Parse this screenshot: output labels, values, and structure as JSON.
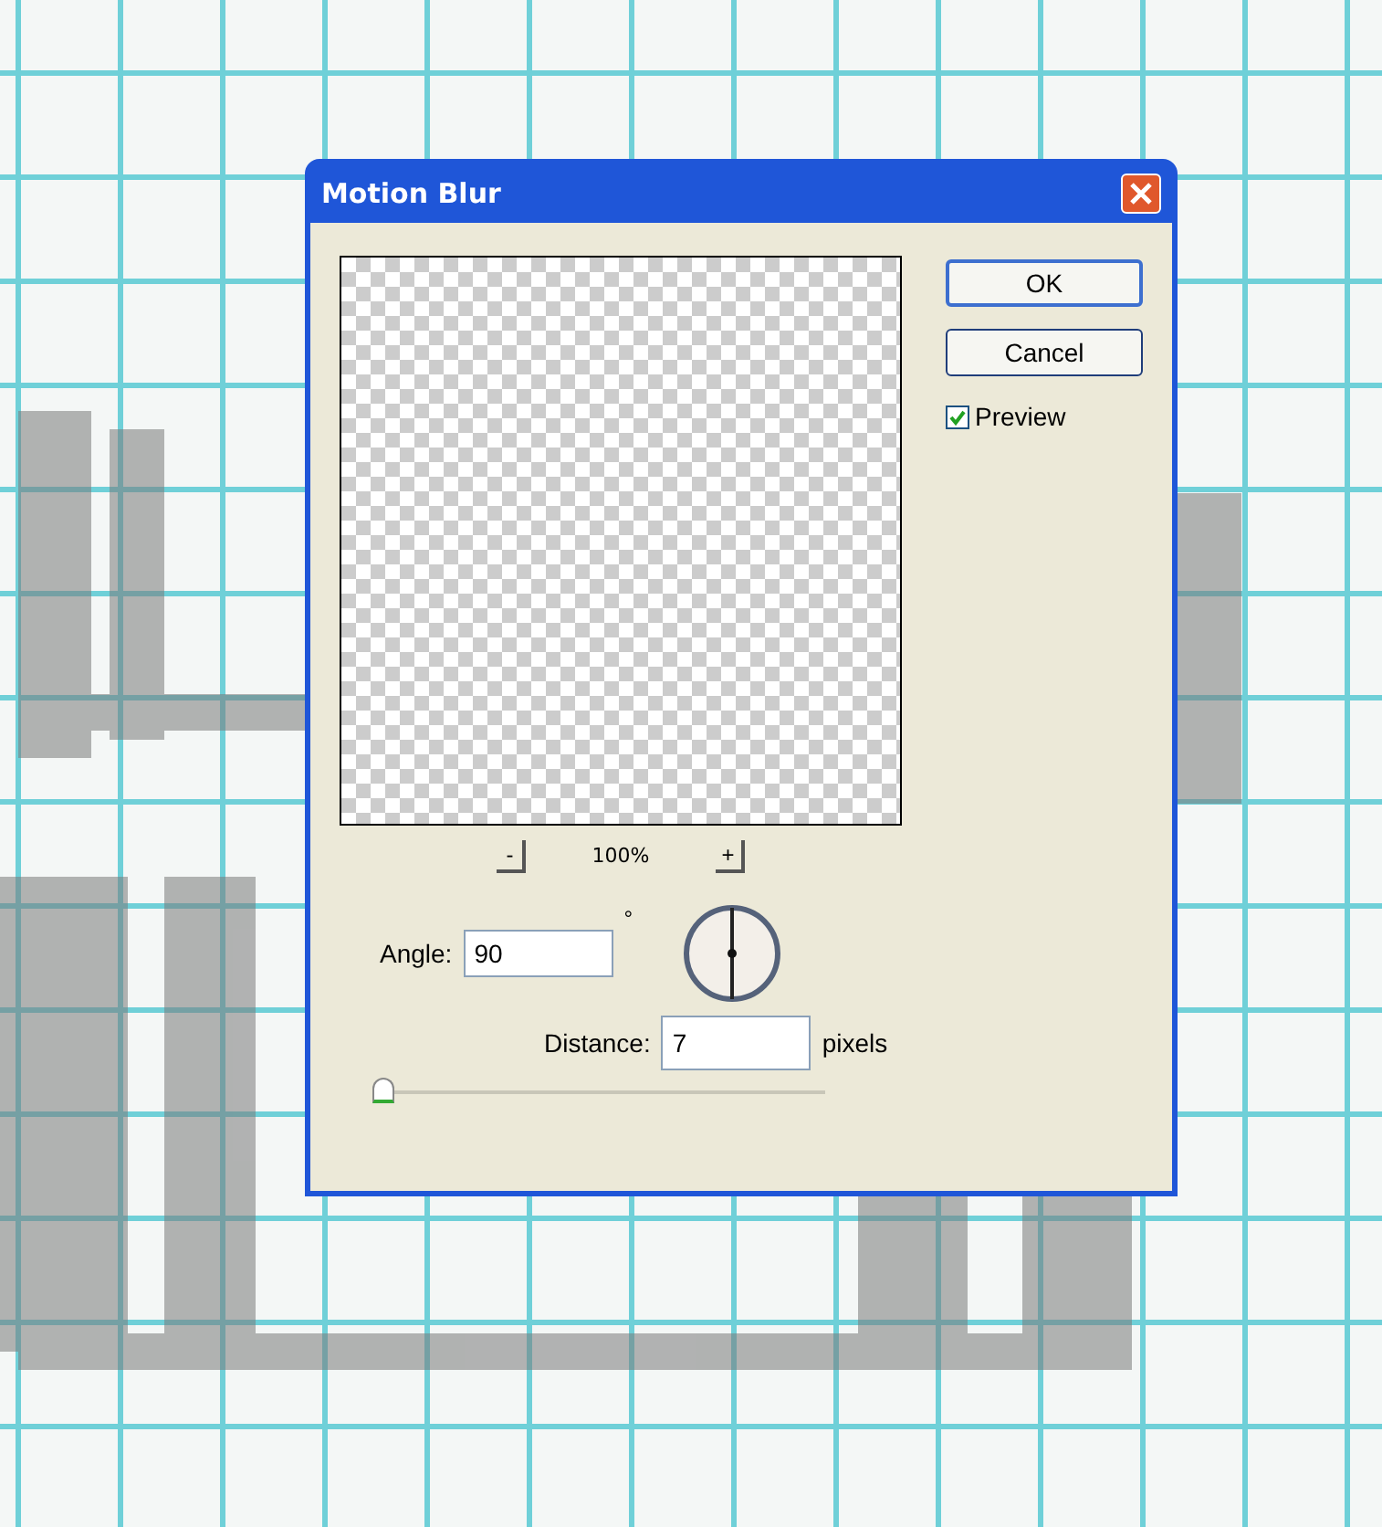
{
  "window": {
    "title": "Motion Blur"
  },
  "buttons": [
    {
      "label": "OK",
      "default": true
    },
    {
      "label": "Cancel",
      "default": false
    }
  ],
  "preview_checkbox": {
    "label": "Preview",
    "checked": true
  },
  "zoom": {
    "minus": "-",
    "value": "100%",
    "plus": "+"
  },
  "angle": {
    "label": "Angle:",
    "value": "90",
    "unit": "°"
  },
  "distance": {
    "label": "Distance:",
    "value": "7",
    "unit": "pixels",
    "level": 0.01
  }
}
